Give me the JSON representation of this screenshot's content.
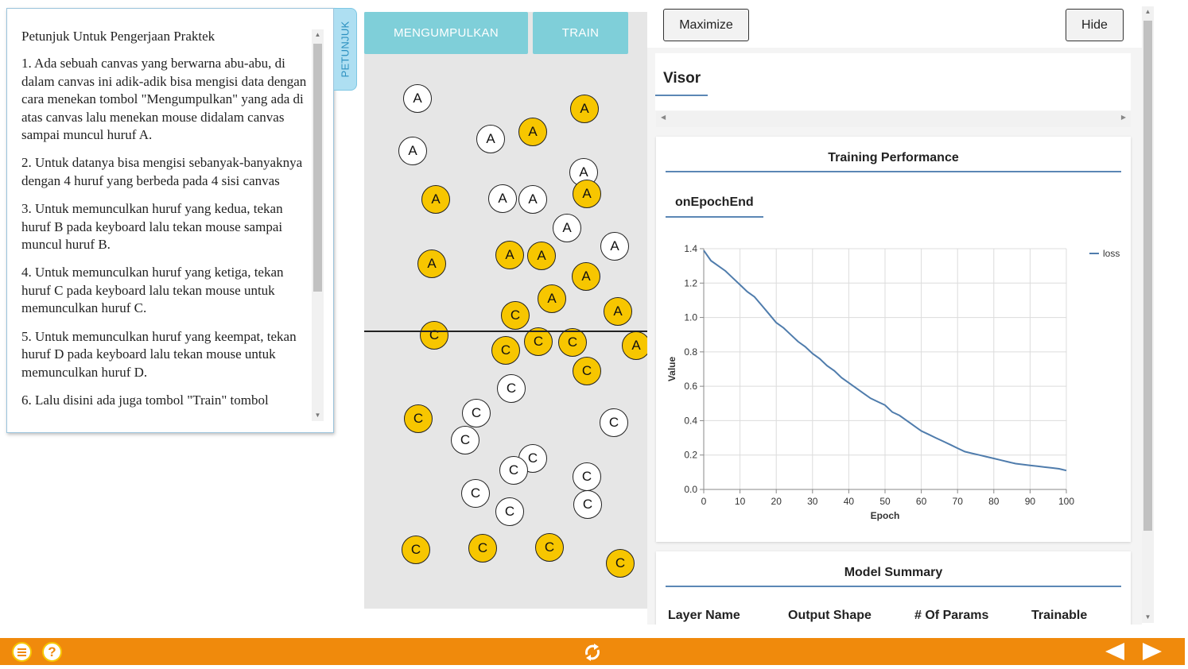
{
  "instructions": {
    "title": "Petunjuk Untuk Pengerjaan Praktek",
    "steps": [
      "1. Ada sebuah canvas yang berwarna abu-abu, di dalam canvas ini adik-adik bisa mengisi data dengan cara menekan tombol \"Mengumpulkan\" yang ada di atas canvas lalu menekan mouse didalam canvas sampai muncul huruf A.",
      "2. Untuk datanya bisa mengisi sebanyak-banyaknya dengan 4 huruf yang berbeda pada 4 sisi canvas",
      "3. Untuk memunculkan huruf yang kedua, tekan huruf B pada keyboard lalu tekan mouse sampai muncul huruf B.",
      "4. Untuk memunculkan huruf yang ketiga, tekan huruf C pada keyboard lalu tekan mouse untuk memunculkan huruf C.",
      "5. Untuk memunculkan huruf yang keempat, tekan huruf D pada keyboard lalu tekan mouse untuk memunculkan huruf D.",
      "6. Lalu disini ada juga tombol \"Train\" tombol"
    ],
    "tab_label": "PETUNJUK"
  },
  "canvas": {
    "collect_button": "MENGUMPULKAN",
    "train_button": "TRAIN",
    "colors": {
      "white": "#ffffff",
      "yellow": "#f7c600",
      "background": "#e6e6e6",
      "button": "#7fcfd9"
    },
    "points": [
      {
        "label": "A",
        "style": 0
      },
      {
        "label": "A",
        "style": 0
      },
      {
        "label": "A",
        "style": 1
      },
      {
        "label": "A",
        "style": 1
      },
      {
        "label": "A",
        "style": 0
      },
      {
        "label": "A",
        "style": 0
      },
      {
        "label": "A",
        "style": 1
      },
      {
        "label": "A",
        "style": 0
      },
      {
        "label": "A",
        "style": 0
      },
      {
        "label": "A",
        "style": 1
      },
      {
        "label": "A",
        "style": 0
      },
      {
        "label": "A",
        "style": 0
      },
      {
        "label": "A",
        "style": 1
      },
      {
        "label": "A",
        "style": 1
      },
      {
        "label": "A",
        "style": 1
      },
      {
        "label": "A",
        "style": 1
      },
      {
        "label": "A",
        "style": 1
      },
      {
        "label": "A",
        "style": 1
      },
      {
        "label": "A",
        "style": 1
      },
      {
        "label": "C",
        "style": 1
      },
      {
        "label": "C",
        "style": 1
      },
      {
        "label": "C",
        "style": 1
      },
      {
        "label": "C",
        "style": 1
      },
      {
        "label": "C",
        "style": 1
      },
      {
        "label": "C",
        "style": 1
      },
      {
        "label": "C",
        "style": 0
      },
      {
        "label": "C",
        "style": 1
      },
      {
        "label": "C",
        "style": 0
      },
      {
        "label": "C",
        "style": 0
      },
      {
        "label": "C",
        "style": 0
      },
      {
        "label": "C",
        "style": 0
      },
      {
        "label": "C",
        "style": 0
      },
      {
        "label": "C",
        "style": 0
      },
      {
        "label": "C",
        "style": 0
      },
      {
        "label": "C",
        "style": 0
      },
      {
        "label": "C",
        "style": 0
      },
      {
        "label": "C",
        "style": 1
      },
      {
        "label": "C",
        "style": 1
      },
      {
        "label": "C",
        "style": 1
      },
      {
        "label": "C",
        "style": 1
      }
    ]
  },
  "visor": {
    "maximize_button": "Maximize",
    "hide_button": "Hide",
    "tab_label": "Visor",
    "training_card": {
      "title": "Training Performance",
      "subtab": "onEpochEnd"
    },
    "model_card": {
      "title": "Model Summary",
      "columns": [
        "Layer Name",
        "Output Shape",
        "# Of Params",
        "Trainable"
      ]
    }
  },
  "chart_data": {
    "type": "line",
    "title": "",
    "xlabel": "Epoch",
    "ylabel": "Value",
    "xlim": [
      0,
      100
    ],
    "ylim": [
      0,
      1.4
    ],
    "xticks": [
      0,
      10,
      20,
      30,
      40,
      50,
      60,
      70,
      80,
      90,
      100
    ],
    "yticks": [
      0.0,
      0.2,
      0.4,
      0.6,
      0.8,
      1.0,
      1.2,
      1.4
    ],
    "ytick_labels": [
      "0.0",
      "0.2",
      "0.4",
      "0.6",
      "0.8",
      "1.0",
      "1.2",
      "1.4"
    ],
    "grid": true,
    "legend_position": "top-right",
    "series": [
      {
        "name": "loss",
        "color": "#4f7cac",
        "x": [
          0,
          2,
          4,
          6,
          8,
          10,
          12,
          14,
          16,
          18,
          20,
          22,
          24,
          26,
          28,
          30,
          32,
          34,
          36,
          38,
          40,
          42,
          44,
          46,
          48,
          50,
          52,
          54,
          56,
          58,
          60,
          62,
          64,
          66,
          68,
          70,
          72,
          74,
          76,
          78,
          80,
          82,
          84,
          86,
          88,
          90,
          92,
          94,
          96,
          98,
          100
        ],
        "values": [
          1.39,
          1.33,
          1.3,
          1.27,
          1.23,
          1.19,
          1.15,
          1.12,
          1.07,
          1.02,
          0.97,
          0.94,
          0.9,
          0.86,
          0.83,
          0.79,
          0.76,
          0.72,
          0.69,
          0.65,
          0.62,
          0.59,
          0.56,
          0.53,
          0.51,
          0.49,
          0.45,
          0.43,
          0.4,
          0.37,
          0.34,
          0.32,
          0.3,
          0.28,
          0.26,
          0.24,
          0.22,
          0.21,
          0.2,
          0.19,
          0.18,
          0.17,
          0.16,
          0.15,
          0.145,
          0.14,
          0.135,
          0.13,
          0.125,
          0.12,
          0.11
        ]
      }
    ]
  }
}
